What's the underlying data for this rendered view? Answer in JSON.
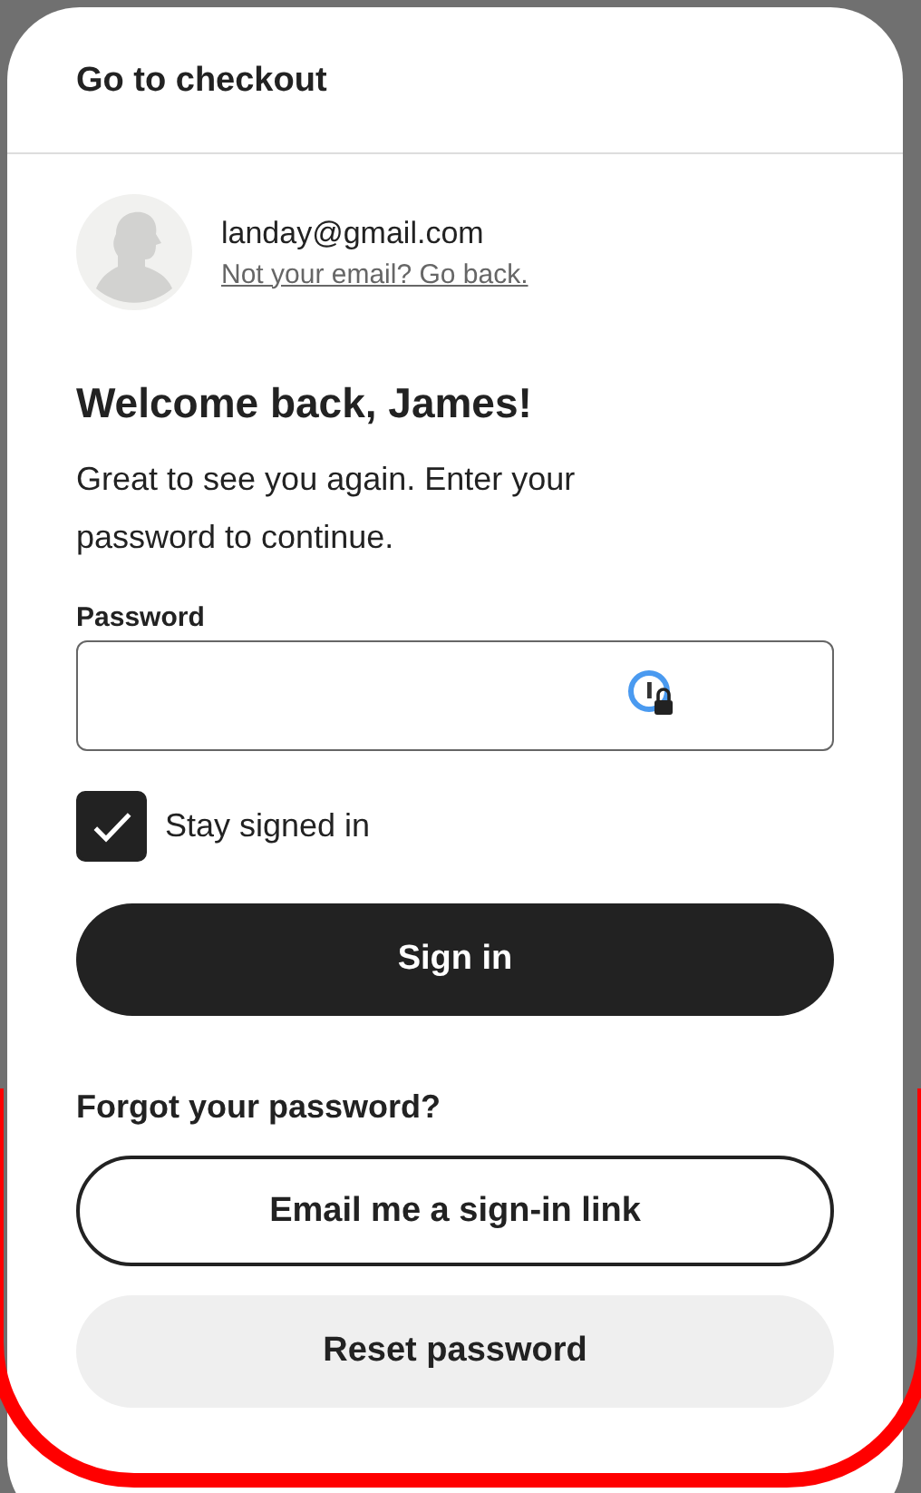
{
  "dialog": {
    "title": "Go to checkout"
  },
  "account": {
    "email": "landay@gmail.com",
    "switch_link": "Not your email? Go back."
  },
  "heading": "Welcome back, James!",
  "message": "Great to see you again. Enter your password to continue.",
  "password": {
    "label": "Password"
  },
  "stay_signed_in": {
    "label": "Stay signed in",
    "checked": true
  },
  "sign_in_button": "Sign in",
  "forgot": {
    "title": "Forgot your password?",
    "buttons": [
      {
        "label": "Email me a sign-in link",
        "kind": "outline"
      },
      {
        "label": "Reset password",
        "kind": "soft"
      }
    ]
  }
}
